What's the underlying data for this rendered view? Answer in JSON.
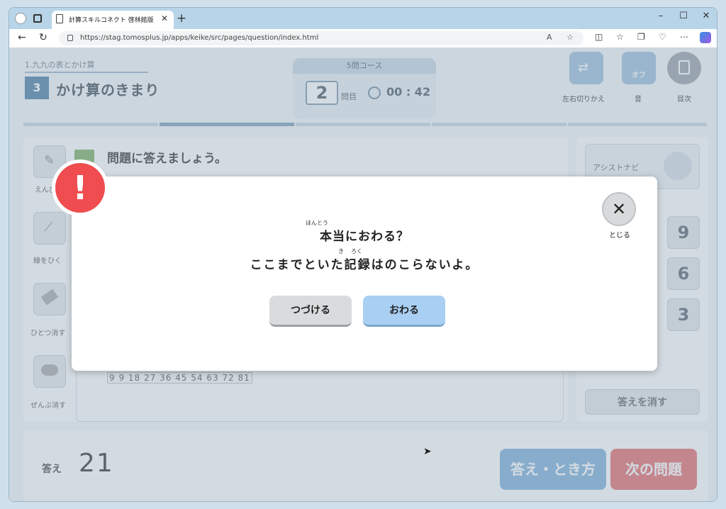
{
  "browser": {
    "tab_title": "計算スキルコネクト 啓林館版",
    "url": "https://stag.tomosplus.jp/apps/keike/src/pages/question/index.html",
    "icons": [
      "profile-icon",
      "tab-actions-icon",
      "page-icon",
      "close-icon",
      "plus-icon",
      "minimize-icon",
      "maximize-icon",
      "window-close-icon",
      "back-icon",
      "refresh-icon",
      "lock-icon",
      "read-aloud-icon",
      "favorite-icon",
      "split-screen-icon",
      "favorites-icon",
      "collections-icon",
      "heart-icon",
      "more-icon",
      "copilot-icon"
    ]
  },
  "header": {
    "unit_title": "1.九九の表とかけ算",
    "lesson_number": "3",
    "lesson_title": "かけ算のきまり",
    "course_label": "5問コース",
    "question_number": "2",
    "question_label": "問目",
    "timer": "00 : 42",
    "switch_label": "左右切りかえ",
    "sound_label": "音",
    "sound_state": "オフ",
    "toc_label": "目次"
  },
  "tools": {
    "pencil": "えんぴ",
    "line": "線をひく",
    "erase_one": "ひとつ消す",
    "erase_all": "ぜんぶ消す"
  },
  "question": {
    "instruction": "問題に答えましょう。",
    "table_row": "9 9 18 27 36 45 54 63 72 81"
  },
  "right_panel": {
    "assist_navi": "アシストナビ",
    "keys": [
      "9",
      "6",
      "3"
    ],
    "clear_answer": "答えを消す"
  },
  "answer": {
    "label": "答え",
    "value": "21",
    "solution_button": "答え・とき方",
    "next_button": "次の問題"
  },
  "modal": {
    "alert_symbol": "!",
    "close_label": "とじる",
    "line1": "本当におわる？",
    "line2": "ここまでといた記録はのこらないよ。",
    "ruby_hontou": "ほんとう",
    "ruby_ki": "き",
    "ruby_roku": "ろく",
    "continue_button": "つづける",
    "end_button": "おわる"
  }
}
